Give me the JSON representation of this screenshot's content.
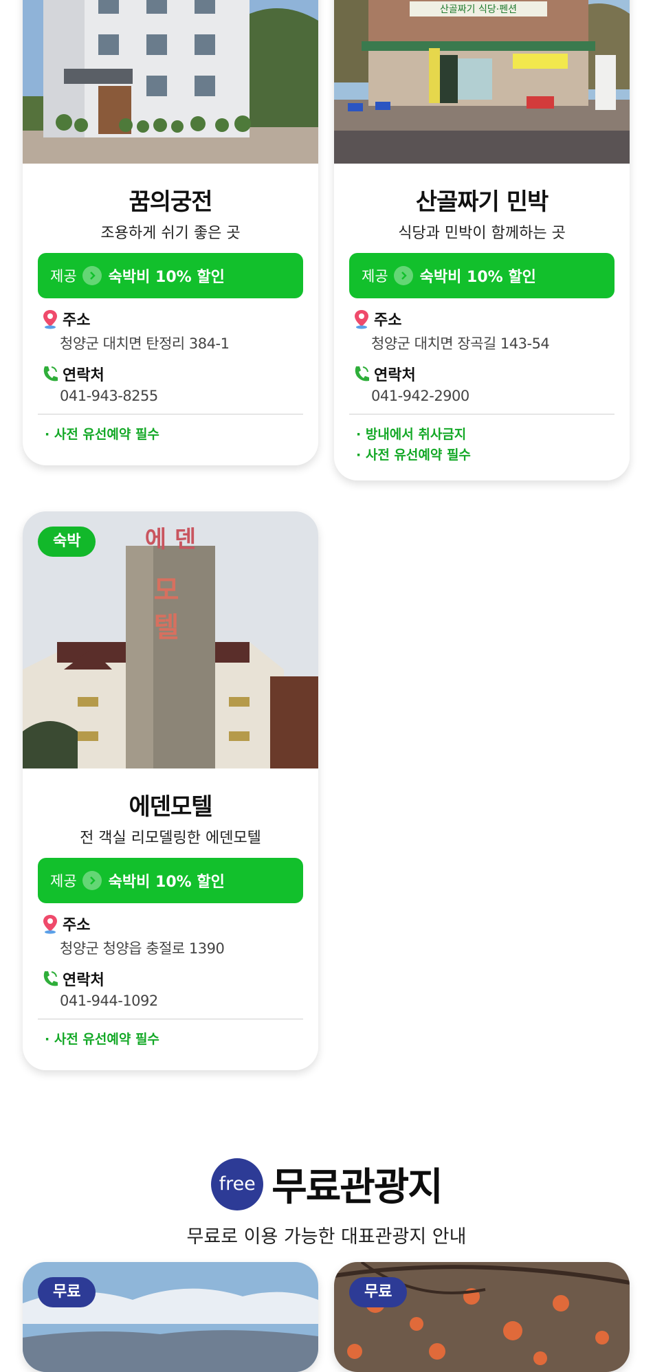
{
  "lodgings": [
    {
      "title": "꿈의궁전",
      "subtitle": "조용하게 쉬기 좋은 곳",
      "benefit_tag": "제공",
      "benefit_text": "숙박비 10% 할인",
      "address_label": "주소",
      "address": "청양군 대치면 탄정리 384-1",
      "contact_label": "연락처",
      "phone": "041-943-8255",
      "notes": [
        "· 사전 유선예약 필수"
      ]
    },
    {
      "title": "산골짜기 민박",
      "subtitle": "식당과 민박이 함께하는 곳",
      "benefit_tag": "제공",
      "benefit_text": "숙박비 10% 할인",
      "address_label": "주소",
      "address": "청양군 대치면 장곡길 143-54",
      "contact_label": "연락처",
      "phone": "041-942-2900",
      "notes": [
        "· 방내에서 취사금지",
        "· 사전 유선예약 필수"
      ]
    },
    {
      "badge": "숙박",
      "title": "에덴모텔",
      "subtitle": "전 객실 리모델링한 에덴모텔",
      "benefit_tag": "제공",
      "benefit_text": "숙박비 10% 할인",
      "address_label": "주소",
      "address": "청양군 청양읍 충절로 1390",
      "contact_label": "연락처",
      "phone": "041-944-1092",
      "notes": [
        "· 사전 유선예약 필수"
      ]
    }
  ],
  "photo_signs": {
    "restaurant_sign": "산골짜기 식당·펜션",
    "motel_top": "에 덴",
    "motel_side": "모 텔"
  },
  "free_section": {
    "circle_text": "free",
    "title": "무료관광지",
    "subtitle": "무료로 이용 가능한 대표관광지 안내",
    "cards": [
      {
        "badge": "무료"
      },
      {
        "badge": "무료"
      }
    ]
  },
  "colors": {
    "benefit_green": "#12c02c",
    "note_green": "#13a826",
    "free_blue": "#2d3b96"
  },
  "icons": {
    "address": "location-pin-icon",
    "contact": "phone-icon",
    "benefit": "arrow-circle-icon"
  }
}
